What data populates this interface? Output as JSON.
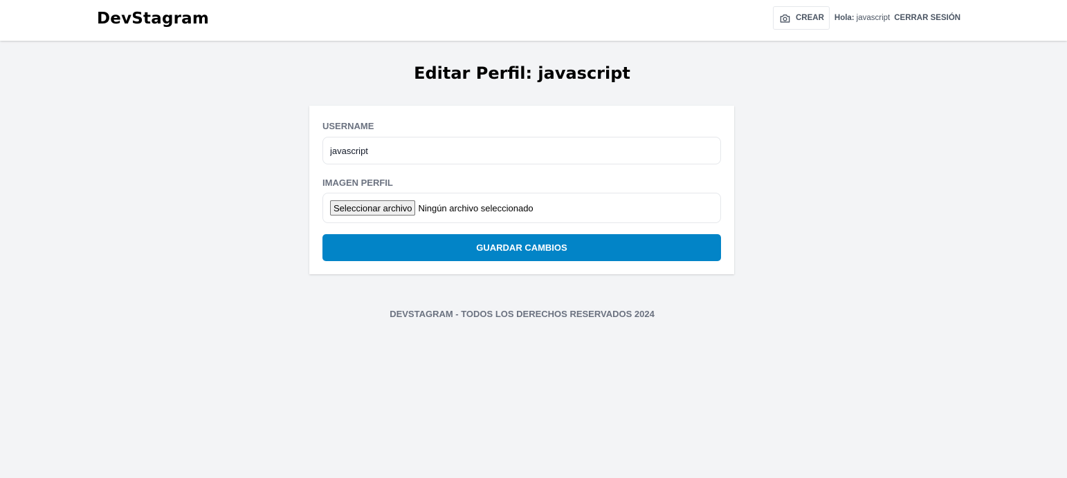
{
  "header": {
    "logo": "DevStagram",
    "create_label": "CREAR",
    "create_icon": "camera-icon",
    "greeting_label": "Hola:",
    "greeting_user": "javascript",
    "logout_label": "CERRAR SESIÓN"
  },
  "page": {
    "title": "Editar Perfil: javascript"
  },
  "form": {
    "username_label": "USERNAME",
    "username_value": "javascript",
    "image_label": "IMAGEN PERFIL",
    "file_button_label": "Seleccionar archivo",
    "file_status": "Ningún archivo seleccionado",
    "submit_label": "GUARDAR CAMBIOS"
  },
  "footer": {
    "text": "DEVSTAGRAM - TODOS LOS DERECHOS RESERVADOS 2024"
  },
  "colors": {
    "background": "#f3f4f6",
    "primary_button": "#0284c7",
    "label_gray": "#6b7280"
  }
}
